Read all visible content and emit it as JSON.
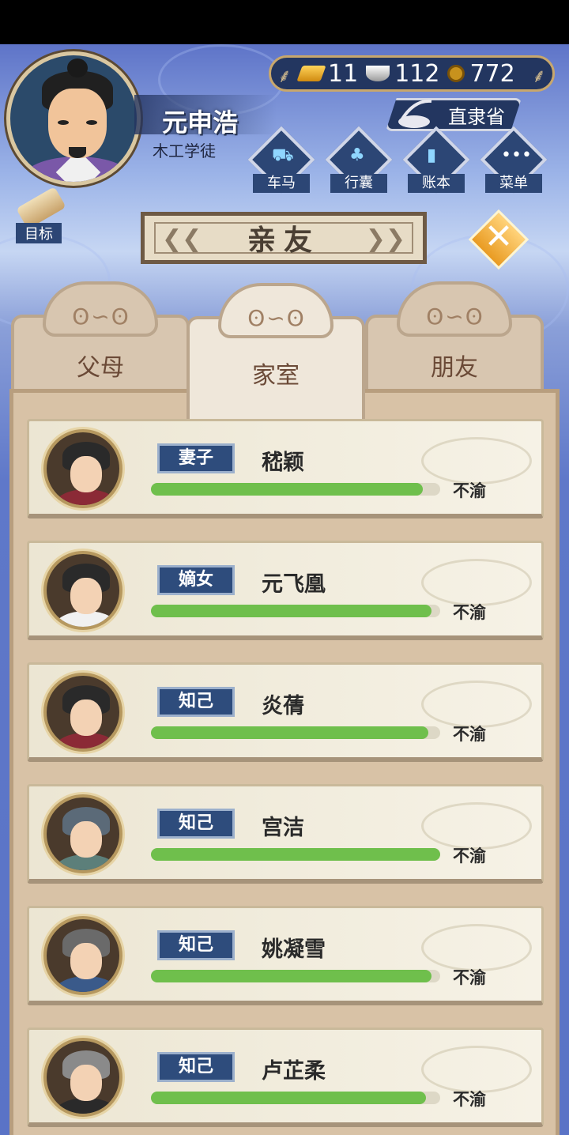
{
  "player": {
    "name": "元申浩",
    "title": "木工学徒"
  },
  "currency": {
    "gold": "11",
    "silver": "112",
    "coins": "772"
  },
  "location": "直隶省",
  "menu": [
    {
      "label": "车马",
      "icon": "carriage-icon"
    },
    {
      "label": "行囊",
      "icon": "bundle-icon"
    },
    {
      "label": "账本",
      "icon": "ledger-icon"
    },
    {
      "label": "菜单",
      "icon": "more-icon"
    }
  ],
  "goal_label": "目标",
  "panel_title": "亲友",
  "tabs": [
    {
      "label": "父母"
    },
    {
      "label": "家室"
    },
    {
      "label": "朋友"
    }
  ],
  "active_tab": "家室",
  "entries": [
    {
      "role": "妻子",
      "name": "嵇颖",
      "status": "不渝",
      "affinity": 0.94
    },
    {
      "role": "嫡女",
      "name": "元飞凰",
      "status": "不渝",
      "affinity": 0.97
    },
    {
      "role": "知己",
      "name": "炎蒨",
      "status": "不渝",
      "affinity": 0.96
    },
    {
      "role": "知己",
      "name": "宫洁",
      "status": "不渝",
      "affinity": 1.0
    },
    {
      "role": "知己",
      "name": "姚凝雪",
      "status": "不渝",
      "affinity": 0.97
    },
    {
      "role": "知己",
      "name": "卢芷柔",
      "status": "不渝",
      "affinity": 0.95
    }
  ]
}
